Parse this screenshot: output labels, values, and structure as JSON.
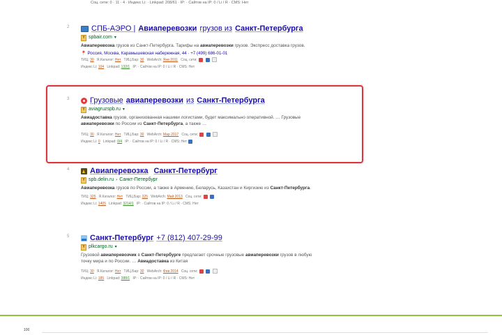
{
  "top_stats": "Соц. сети: 0 · 11 · 4 · Индекс Li: · Linkpad: 208/61 · IP: · Сайтов на IP: 0 / Li / R · CMS: Нет",
  "results": [
    {
      "num": "2",
      "title_pre": "СПБ-АЭРО | ",
      "title_bold": "Авиаперевозки",
      "title_mid": " грузов из ",
      "title_bold2": "Санкт-Петербурга",
      "url": "spbair.com",
      "snippet_b1": "Авиаперевозка",
      "snippet_1": " грузов из Санкт-Петербурга. Тарифы на ",
      "snippet_b2": "авиаперевозки",
      "snippet_2": " грузов. Экспресс доставка грузов.",
      "address": "Россия, Москва, Карамышевская набережная, 44 · +7 (499) 686-01-01",
      "stats1_label": "ТИЦ:",
      "stats1_v": "30",
      "stats1_rest": "Я.Каталог:",
      "stats1_v2": "Нет",
      "stats1_tyc": "ТИЦ.Бар:",
      "stats1_v3": "30",
      "stats1_wa": "WebArch:",
      "stats1_v4": "Янв 2011",
      "stats1_soc": "Соц. сети:",
      "stats2_label": "Индекс Li:",
      "stats2_v": "104",
      "stats2_lp": "Linkpad:",
      "stats2_v2": "132/1",
      "stats2_rest": "IP: · Сайтов на IP: 0 / Li / R · CMS: Нет"
    },
    {
      "num": "3",
      "title_pre": "Грузовые ",
      "title_bold": "авиаперевозки",
      "title_mid": " из ",
      "title_bold2": "Санкт-Петербурга",
      "url": "aviagruzspb.ru",
      "snippet_b1": "Авиадоставка",
      "snippet_1": " грузов, организованная нашими логистами, будет максимально оперативной. … Грузовые ",
      "snippet_b2": "авиаперевозки",
      "snippet_2": " по России из ",
      "snippet_b3": "Санкт-Петербурга",
      "snippet_3": ", а также …",
      "stats1_label": "ТИЦ:",
      "stats1_v": "30",
      "stats1_rest": "Я.Каталог:",
      "stats1_v2": "Нет",
      "stats1_tyc": "ТИЦ.Бар:",
      "stats1_v3": "30",
      "stats1_wa": "WebArch:",
      "stats1_v4": "Мар 2017",
      "stats1_soc": "Соц. сети:",
      "stats2_label": "Индекс Li:",
      "stats2_v": "0",
      "stats2_lp": "Linkpad:",
      "stats2_v2": "0/4",
      "stats2_rest": "IP: · Сайтов на IP: 0 / Li / R · CMS: Нет"
    },
    {
      "num": "4",
      "title_bold": "Авиаперевозка",
      "title_mid": " ",
      "title_bold2": "Санкт-Петербург",
      "url": "spb.delin.ru",
      "url_crumb": "Санкт-Петербург",
      "snippet_b1": "Авиаперевозка",
      "snippet_1": " грузов по России, а также в Армению, Беларусь, Казахстан и Киргизию из ",
      "snippet_b2": "Санкт-Петербурга",
      "snippet_2": ".",
      "stats1_label": "ТИЦ:",
      "stats1_v": "325",
      "stats1_rest": "Я.Каталог:",
      "stats1_v2": "Нет",
      "stats1_tyc": "ТИЦ.Бар:",
      "stats1_v3": "325",
      "stats1_wa": "WebArch:",
      "stats1_v4": "Май 2013",
      "stats1_soc": "Соц. сети:",
      "stats2_label": "Индекс Li:",
      "stats2_v": "1405",
      "stats2_lp": "Linkpad:",
      "stats2_v2": "3214/1",
      "stats2_rest": "IP: · Сайтов на IP: 0 / Li / R · CMS: Нет"
    },
    {
      "num": "5",
      "title_bold": "Санкт-Петербург",
      "title_mid": " +7 (812) 407-29-99",
      "url": "plkcargo.ru",
      "snippet_1a": "Грузовой ",
      "snippet_b1": "авиаперевозчик",
      "snippet_1": " в ",
      "snippet_b2": "Санкт-Петербурге",
      "snippet_2": " предлагает срочные грузовые ",
      "snippet_b3": "авиаперевозки",
      "snippet_3": " грузов в любую точку мира и по России. … ",
      "snippet_b4": "Авиадоставка",
      "snippet_4": " из Китая",
      "stats1_label": "ТИЦ:",
      "stats1_v": "30",
      "stats1_rest": "Я.Каталог:",
      "stats1_v2": "Нет",
      "stats1_tyc": "ТИЦ.Бар:",
      "stats1_v3": "30",
      "stats1_wa": "WebArch:",
      "stats1_v4": "Фев 2014",
      "stats1_soc": "Соц. сети:",
      "stats2_label": "Индекс Li:",
      "stats2_v": "185",
      "stats2_lp": "Linkpad:",
      "stats2_v2": "388/1",
      "stats2_rest": "IP: · Сайтов на IP: 0 / Li / R · CMS: Нет"
    }
  ],
  "footer": {
    "page_num": "100"
  },
  "colors": {
    "link": "#1a0dab",
    "url": "#006621",
    "highlight": "#d9363e",
    "divider": "#8cc63f"
  }
}
